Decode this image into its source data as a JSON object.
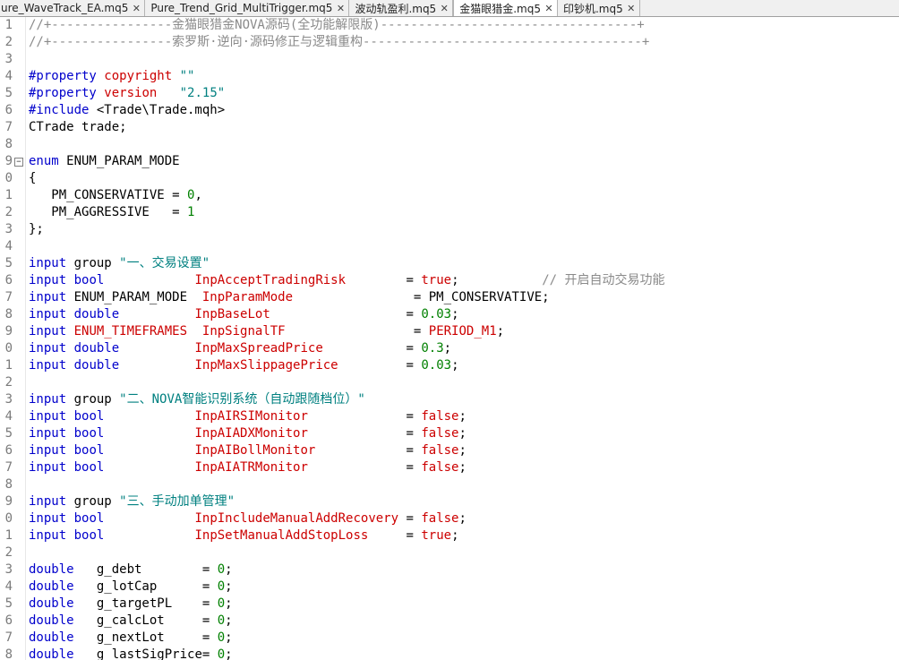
{
  "tabs": [
    {
      "label": "ure_WaveTrack_EA.mq5",
      "active": false
    },
    {
      "label": "Pure_Trend_Grid_MultiTrigger.mq5",
      "active": false
    },
    {
      "label": "波动轨盈利.mq5",
      "active": false
    },
    {
      "label": "金猫眼猎金.mq5",
      "active": true
    },
    {
      "label": "印钞机.mq5",
      "active": false
    }
  ],
  "close_glyph": "✕",
  "fold_glyph": "−",
  "lines": [
    {
      "n": "1",
      "parts": [
        [
          "c-com",
          "//+----------------金猫眼猎金NOVA源码(全功能解限版)----------------------------------+"
        ]
      ]
    },
    {
      "n": "2",
      "parts": [
        [
          "c-com",
          "//+----------------索罗斯·逆向·源码修正与逻辑重构-------------------------------------+"
        ]
      ]
    },
    {
      "n": "3",
      "parts": []
    },
    {
      "n": "4",
      "parts": [
        [
          "c-prop",
          "#property "
        ],
        [
          "c-red",
          "copyright"
        ],
        [
          "c-txt",
          " "
        ],
        [
          "c-str",
          "\"\""
        ]
      ]
    },
    {
      "n": "5",
      "parts": [
        [
          "c-prop",
          "#property "
        ],
        [
          "c-red",
          "version"
        ],
        [
          "c-txt",
          "   "
        ],
        [
          "c-str",
          "\"2.15\""
        ]
      ]
    },
    {
      "n": "6",
      "parts": [
        [
          "c-prop",
          "#include "
        ],
        [
          "c-txt",
          "<Trade\\Trade.mqh>"
        ]
      ]
    },
    {
      "n": "7",
      "parts": [
        [
          "c-txt",
          "CTrade trade;"
        ]
      ]
    },
    {
      "n": "8",
      "parts": []
    },
    {
      "n": "9",
      "fold": true,
      "parts": [
        [
          "c-kw",
          "enum"
        ],
        [
          "c-txt",
          " ENUM_PARAM_MODE"
        ]
      ]
    },
    {
      "n": "0",
      "parts": [
        [
          "c-txt",
          "{"
        ]
      ]
    },
    {
      "n": "1",
      "parts": [
        [
          "c-txt",
          "   PM_CONSERVATIVE = "
        ],
        [
          "c-num",
          "0"
        ],
        [
          "c-txt",
          ","
        ]
      ]
    },
    {
      "n": "2",
      "parts": [
        [
          "c-txt",
          "   PM_AGGRESSIVE   = "
        ],
        [
          "c-num",
          "1"
        ]
      ]
    },
    {
      "n": "3",
      "parts": [
        [
          "c-txt",
          "};"
        ]
      ]
    },
    {
      "n": "4",
      "parts": []
    },
    {
      "n": "5",
      "parts": [
        [
          "c-kw",
          "input"
        ],
        [
          "c-txt",
          " group "
        ],
        [
          "c-str",
          "\"一、交易设置\""
        ]
      ]
    },
    {
      "n": "6",
      "parts": [
        [
          "c-kw",
          "input"
        ],
        [
          "c-txt",
          " "
        ],
        [
          "c-kw",
          "bool"
        ],
        [
          "c-txt",
          "            "
        ],
        [
          "c-var",
          "InpAcceptTradingRisk"
        ],
        [
          "c-txt",
          "        = "
        ],
        [
          "c-red",
          "true"
        ],
        [
          "c-txt",
          ";           "
        ],
        [
          "c-com",
          "// 开启自动交易功能"
        ]
      ]
    },
    {
      "n": "7",
      "parts": [
        [
          "c-kw",
          "input"
        ],
        [
          "c-txt",
          " ENUM_PARAM_MODE  "
        ],
        [
          "c-var",
          "InpParamMode"
        ],
        [
          "c-txt",
          "                = PM_CONSERVATIVE;"
        ]
      ]
    },
    {
      "n": "8",
      "parts": [
        [
          "c-kw",
          "input"
        ],
        [
          "c-txt",
          " "
        ],
        [
          "c-kw",
          "double"
        ],
        [
          "c-txt",
          "          "
        ],
        [
          "c-var",
          "InpBaseLot"
        ],
        [
          "c-txt",
          "                  = "
        ],
        [
          "c-num",
          "0.03"
        ],
        [
          "c-txt",
          ";"
        ]
      ]
    },
    {
      "n": "9",
      "parts": [
        [
          "c-kw",
          "input"
        ],
        [
          "c-txt",
          " "
        ],
        [
          "c-red",
          "ENUM_TIMEFRAMES"
        ],
        [
          "c-txt",
          "  "
        ],
        [
          "c-var",
          "InpSignalTF"
        ],
        [
          "c-txt",
          "                 = "
        ],
        [
          "c-red",
          "PERIOD_M1"
        ],
        [
          "c-txt",
          ";"
        ]
      ]
    },
    {
      "n": "0",
      "parts": [
        [
          "c-kw",
          "input"
        ],
        [
          "c-txt",
          " "
        ],
        [
          "c-kw",
          "double"
        ],
        [
          "c-txt",
          "          "
        ],
        [
          "c-var",
          "InpMaxSpreadPrice"
        ],
        [
          "c-txt",
          "           = "
        ],
        [
          "c-num",
          "0.3"
        ],
        [
          "c-txt",
          ";"
        ]
      ]
    },
    {
      "n": "1",
      "parts": [
        [
          "c-kw",
          "input"
        ],
        [
          "c-txt",
          " "
        ],
        [
          "c-kw",
          "double"
        ],
        [
          "c-txt",
          "          "
        ],
        [
          "c-var",
          "InpMaxSlippagePrice"
        ],
        [
          "c-txt",
          "         = "
        ],
        [
          "c-num",
          "0.03"
        ],
        [
          "c-txt",
          ";"
        ]
      ]
    },
    {
      "n": "2",
      "parts": []
    },
    {
      "n": "3",
      "parts": [
        [
          "c-kw",
          "input"
        ],
        [
          "c-txt",
          " group "
        ],
        [
          "c-str",
          "\"二、NOVA智能识别系统（自动跟随档位）\""
        ]
      ]
    },
    {
      "n": "4",
      "parts": [
        [
          "c-kw",
          "input"
        ],
        [
          "c-txt",
          " "
        ],
        [
          "c-kw",
          "bool"
        ],
        [
          "c-txt",
          "            "
        ],
        [
          "c-var",
          "InpAIRSIMonitor"
        ],
        [
          "c-txt",
          "             = "
        ],
        [
          "c-red",
          "false"
        ],
        [
          "c-txt",
          ";"
        ]
      ]
    },
    {
      "n": "5",
      "parts": [
        [
          "c-kw",
          "input"
        ],
        [
          "c-txt",
          " "
        ],
        [
          "c-kw",
          "bool"
        ],
        [
          "c-txt",
          "            "
        ],
        [
          "c-var",
          "InpAIADXMonitor"
        ],
        [
          "c-txt",
          "             = "
        ],
        [
          "c-red",
          "false"
        ],
        [
          "c-txt",
          ";"
        ]
      ]
    },
    {
      "n": "6",
      "parts": [
        [
          "c-kw",
          "input"
        ],
        [
          "c-txt",
          " "
        ],
        [
          "c-kw",
          "bool"
        ],
        [
          "c-txt",
          "            "
        ],
        [
          "c-var",
          "InpAIBollMonitor"
        ],
        [
          "c-txt",
          "            = "
        ],
        [
          "c-red",
          "false"
        ],
        [
          "c-txt",
          ";"
        ]
      ]
    },
    {
      "n": "7",
      "parts": [
        [
          "c-kw",
          "input"
        ],
        [
          "c-txt",
          " "
        ],
        [
          "c-kw",
          "bool"
        ],
        [
          "c-txt",
          "            "
        ],
        [
          "c-var",
          "InpAIATRMonitor"
        ],
        [
          "c-txt",
          "             = "
        ],
        [
          "c-red",
          "false"
        ],
        [
          "c-txt",
          ";"
        ]
      ]
    },
    {
      "n": "8",
      "parts": []
    },
    {
      "n": "9",
      "parts": [
        [
          "c-kw",
          "input"
        ],
        [
          "c-txt",
          " group "
        ],
        [
          "c-str",
          "\"三、手动加单管理\""
        ]
      ]
    },
    {
      "n": "0",
      "parts": [
        [
          "c-kw",
          "input"
        ],
        [
          "c-txt",
          " "
        ],
        [
          "c-kw",
          "bool"
        ],
        [
          "c-txt",
          "            "
        ],
        [
          "c-var",
          "InpIncludeManualAddRecovery"
        ],
        [
          "c-txt",
          " = "
        ],
        [
          "c-red",
          "false"
        ],
        [
          "c-txt",
          ";"
        ]
      ]
    },
    {
      "n": "1",
      "parts": [
        [
          "c-kw",
          "input"
        ],
        [
          "c-txt",
          " "
        ],
        [
          "c-kw",
          "bool"
        ],
        [
          "c-txt",
          "            "
        ],
        [
          "c-var",
          "InpSetManualAddStopLoss"
        ],
        [
          "c-txt",
          "     = "
        ],
        [
          "c-red",
          "true"
        ],
        [
          "c-txt",
          ";"
        ]
      ]
    },
    {
      "n": "2",
      "parts": []
    },
    {
      "n": "3",
      "parts": [
        [
          "c-kw",
          "double"
        ],
        [
          "c-txt",
          "   g_debt        = "
        ],
        [
          "c-num",
          "0"
        ],
        [
          "c-txt",
          ";"
        ]
      ]
    },
    {
      "n": "4",
      "parts": [
        [
          "c-kw",
          "double"
        ],
        [
          "c-txt",
          "   g_lotCap      = "
        ],
        [
          "c-num",
          "0"
        ],
        [
          "c-txt",
          ";"
        ]
      ]
    },
    {
      "n": "5",
      "parts": [
        [
          "c-kw",
          "double"
        ],
        [
          "c-txt",
          "   g_targetPL    = "
        ],
        [
          "c-num",
          "0"
        ],
        [
          "c-txt",
          ";"
        ]
      ]
    },
    {
      "n": "6",
      "parts": [
        [
          "c-kw",
          "double"
        ],
        [
          "c-txt",
          "   g_calcLot     = "
        ],
        [
          "c-num",
          "0"
        ],
        [
          "c-txt",
          ";"
        ]
      ]
    },
    {
      "n": "7",
      "parts": [
        [
          "c-kw",
          "double"
        ],
        [
          "c-txt",
          "   g_nextLot     = "
        ],
        [
          "c-num",
          "0"
        ],
        [
          "c-txt",
          ";"
        ]
      ]
    },
    {
      "n": "8",
      "parts": [
        [
          "c-kw",
          "double"
        ],
        [
          "c-txt",
          "   g_lastSigPrice= "
        ],
        [
          "c-num",
          "0"
        ],
        [
          "c-txt",
          ";"
        ]
      ]
    }
  ]
}
